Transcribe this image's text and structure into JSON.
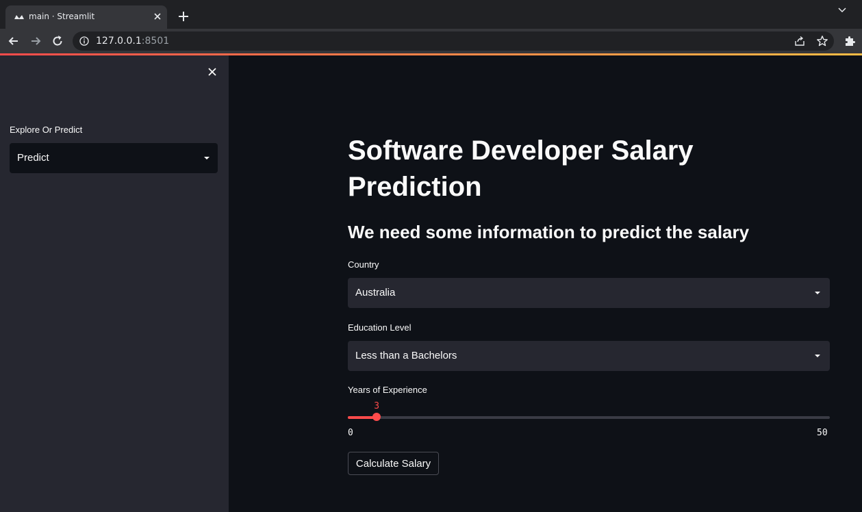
{
  "browser": {
    "tab_title": "main · Streamlit",
    "url_host": "127.0.0.1",
    "url_port": ":8501",
    "icons": [
      "streamlit-favicon-icon",
      "close-icon",
      "plus-icon",
      "chevron-down-icon",
      "arrow-left-icon",
      "arrow-right-icon",
      "reload-icon",
      "info-icon",
      "share-icon",
      "star-icon",
      "puzzle-icon"
    ]
  },
  "sidebar": {
    "label": "Explore Or Predict",
    "selected": "Predict"
  },
  "main": {
    "title": "Software Developer Salary Prediction",
    "subtitle": "We need some information to predict the salary",
    "country": {
      "label": "Country",
      "selected": "Australia"
    },
    "education": {
      "label": "Education Level",
      "selected": "Less than a Bachelors"
    },
    "experience": {
      "label": "Years of Experience",
      "value": "3",
      "min": "0",
      "max": "50",
      "numeric_value": 3,
      "numeric_min": 0,
      "numeric_max": 50
    },
    "button_label": "Calculate Salary"
  },
  "colors": {
    "accent": "#ff4b4b",
    "background": "#0e1117",
    "sidebar": "#262730"
  }
}
